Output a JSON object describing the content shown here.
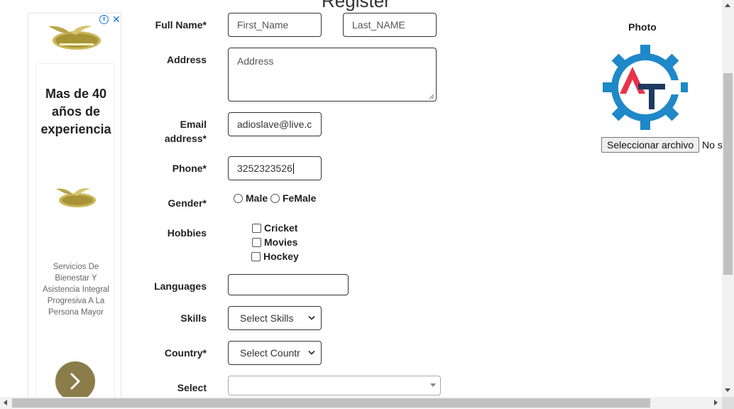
{
  "page": {
    "title": "Register"
  },
  "ad": {
    "headline": "Mas de 40 años de experiencia",
    "body": "Servicios De Bienestar Y Asistencia Integral Progresiva A La Persona Mayor",
    "info_icon": "info-icon",
    "close_icon": "close-icon",
    "next_icon": "chevron-right-icon",
    "accent": "#8a7d4a"
  },
  "form": {
    "full_name": {
      "label": "Full Name*",
      "first_placeholder": "First_Name",
      "last_placeholder": "Last_NAME"
    },
    "address": {
      "label": "Address",
      "placeholder": "Address"
    },
    "email": {
      "label_line1": "Email",
      "label_line2": "address*",
      "value": "adioslave@live.c"
    },
    "phone": {
      "label": "Phone*",
      "value": "3252323526"
    },
    "gender": {
      "label": "Gender*",
      "options": [
        "Male",
        "FeMale"
      ]
    },
    "hobbies": {
      "label": "Hobbies",
      "options": [
        "Cricket",
        "Movies",
        "Hockey"
      ]
    },
    "languages": {
      "label": "Languages",
      "value": ""
    },
    "skills": {
      "label": "Skills",
      "selected": "Select Skills"
    },
    "country": {
      "label": "Country*",
      "selected": "Select Countr"
    },
    "select": {
      "label": "Select",
      "selected": ""
    }
  },
  "photo": {
    "label": "Photo",
    "file_button": "Seleccionar archivo",
    "file_status": "No s",
    "logo_colors": {
      "gear": "#1e88c8",
      "a": "#e8334a",
      "t": "#1e3a5f"
    }
  }
}
